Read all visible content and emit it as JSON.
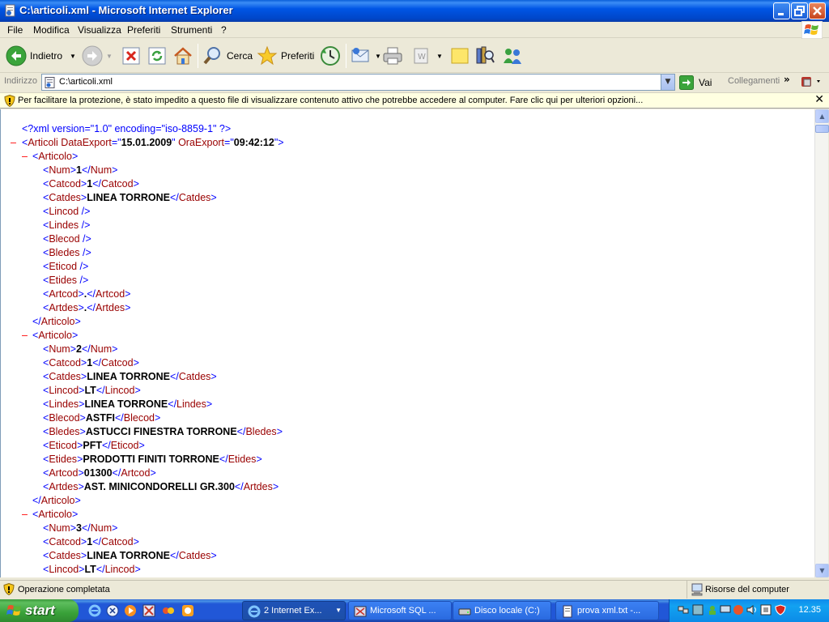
{
  "window": {
    "title": "C:\\articoli.xml - Microsoft Internet Explorer"
  },
  "menu": [
    "File",
    "Modifica",
    "Visualizza",
    "Preferiti",
    "Strumenti",
    "?"
  ],
  "toolbar": {
    "back_label": "Indietro",
    "search_label": "Cerca",
    "favorites_label": "Preferiti"
  },
  "address": {
    "label": "Indirizzo",
    "value": "C:\\articoli.xml",
    "go_label": "Vai",
    "links_label": "Collegamenti"
  },
  "infobar": {
    "text": "Per facilitare la protezione, è stato impedito a questo file di visualizzare contenuto attivo che potrebbe accedere al computer. Fare clic qui per ulteriori opzioni..."
  },
  "xml": {
    "declaration": "<?xml version=\"1.0\" encoding=\"iso-8859-1\" ?>",
    "root_tag": "Articoli",
    "root_attrs": [
      {
        "name": "DataExport",
        "value": "15.01.2009"
      },
      {
        "name": "OraExport",
        "value": "09:42:12"
      }
    ],
    "record_tag": "Articolo",
    "records": [
      {
        "fields": [
          {
            "tag": "Num",
            "value": "1"
          },
          {
            "tag": "Catcod",
            "value": "1"
          },
          {
            "tag": "Catdes",
            "value": "LINEA TORRONE"
          },
          {
            "tag": "Lincod",
            "value": ""
          },
          {
            "tag": "Lindes",
            "value": ""
          },
          {
            "tag": "Blecod",
            "value": ""
          },
          {
            "tag": "Bledes",
            "value": ""
          },
          {
            "tag": "Eticod",
            "value": ""
          },
          {
            "tag": "Etides",
            "value": ""
          },
          {
            "tag": "Artcod",
            "value": "."
          },
          {
            "tag": "Artdes",
            "value": "."
          }
        ]
      },
      {
        "fields": [
          {
            "tag": "Num",
            "value": "2"
          },
          {
            "tag": "Catcod",
            "value": "1"
          },
          {
            "tag": "Catdes",
            "value": "LINEA TORRONE"
          },
          {
            "tag": "Lincod",
            "value": "LT"
          },
          {
            "tag": "Lindes",
            "value": "LINEA TORRONE"
          },
          {
            "tag": "Blecod",
            "value": "ASTFI"
          },
          {
            "tag": "Bledes",
            "value": "ASTUCCI FINESTRA TORRONE"
          },
          {
            "tag": "Eticod",
            "value": "PFT"
          },
          {
            "tag": "Etides",
            "value": "PRODOTTI FINITI TORRONE"
          },
          {
            "tag": "Artcod",
            "value": "01300"
          },
          {
            "tag": "Artdes",
            "value": "AST. MINICONDORELLI GR.300"
          }
        ]
      },
      {
        "fields": [
          {
            "tag": "Num",
            "value": "3"
          },
          {
            "tag": "Catcod",
            "value": "1"
          },
          {
            "tag": "Catdes",
            "value": "LINEA TORRONE"
          },
          {
            "tag": "Lincod",
            "value": "LT"
          }
        ]
      }
    ]
  },
  "status": {
    "text": "Operazione completata",
    "zone": "Risorse del computer"
  },
  "taskbar": {
    "start_label": "start",
    "tasks": [
      {
        "label": "2 Internet Ex...",
        "active": true,
        "has_arrow": true
      },
      {
        "label": "Microsoft SQL ...",
        "active": false,
        "has_arrow": false
      },
      {
        "label": "Disco locale (C:)",
        "active": false,
        "has_arrow": false
      },
      {
        "label": "prova xml.txt -...",
        "active": false,
        "has_arrow": false
      }
    ],
    "clock": "12.35"
  }
}
